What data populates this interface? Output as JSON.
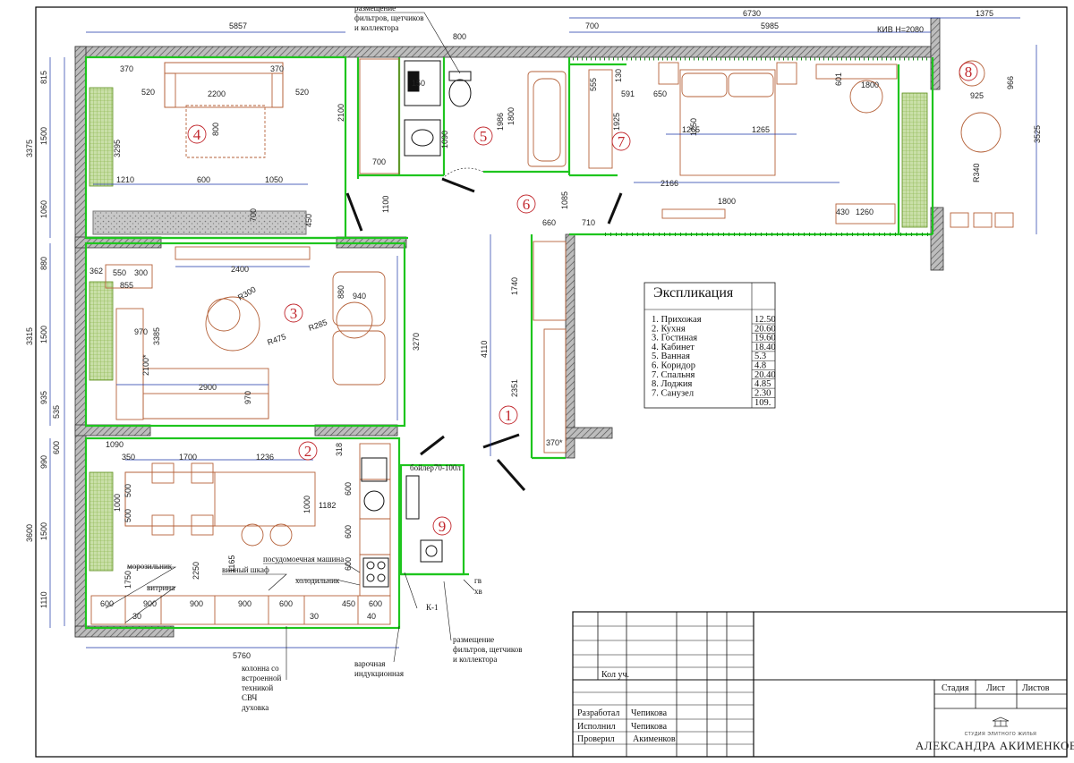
{
  "rooms": {
    "r1": "1",
    "r2": "2",
    "r3": "3",
    "r4": "4",
    "r5": "5",
    "r6": "6",
    "r7": "7",
    "r8": "8",
    "r9": "9"
  },
  "dims": {
    "top_left": "5857",
    "top_right": "6730",
    "top_far": "1375",
    "d800": "800",
    "d700a": "700",
    "d5985": "5985",
    "kiv": "КИВ Н=2080",
    "d520a": "520",
    "d2200": "2200",
    "d520b": "520",
    "d370a": "370",
    "d370b": "370",
    "d800b": "800",
    "d3295": "3295",
    "d1210": "1210",
    "d600a": "600",
    "d1050": "1050",
    "d700b": "700",
    "d450a": "450",
    "d2100a": "2100",
    "d1100": "1100",
    "d700c": "700",
    "d1986": "1986",
    "d1800a": "1800",
    "d1090a": "1090",
    "d150": "150",
    "d555": "555",
    "d130": "130",
    "d591": "591",
    "d650": "650",
    "d1925": "1925",
    "d1250": "1250",
    "d1265a": "1265",
    "d1265b": "1265",
    "d2166": "2166",
    "d1800b": "1800",
    "d601": "601",
    "d1800c": "1800",
    "d925": "925",
    "d966": "966",
    "r340": "R340",
    "d3525": "3525",
    "d430": "430",
    "d1260": "1260",
    "d660": "660",
    "d710": "710",
    "d1085": "1085",
    "d2400": "2400",
    "d362": "362",
    "d550": "550",
    "d300": "300",
    "d855": "855",
    "r300": "R300",
    "r285": "R285",
    "r475": "R475",
    "d880": "880",
    "d940": "940",
    "d970a": "970",
    "d3385": "3385",
    "d2100b": "2100*",
    "d2900": "2900",
    "d970b": "970",
    "d3270": "3270",
    "d1740": "1740",
    "d4110": "4110",
    "d2351": "2351",
    "d370c": "370*",
    "d1090b": "1090",
    "d1700": "1700",
    "d1236": "1236",
    "d318": "318",
    "d350": "350",
    "d1000a": "1000",
    "d500a": "500",
    "d500b": "500",
    "d1000b": "1000",
    "d1182": "1182",
    "d600b": "600",
    "d600c": "600",
    "d600d": "600",
    "d2250": "2250",
    "d1165": "1165",
    "d1750": "1750",
    "d30a": "30",
    "d30b": "30",
    "d5760": "5760",
    "w600a": "600",
    "w900a": "900",
    "w900b": "900",
    "w900c": "900",
    "w600b": "600",
    "w450": "450",
    "w600c": "600",
    "w40": "40",
    "left815": "815",
    "left1500a": "1500",
    "left3375": "3375",
    "left1060": "1060",
    "left880": "880",
    "left1500b": "1500",
    "left3315": "3315",
    "left935": "935",
    "left535": "535",
    "left990": "990",
    "left600": "600",
    "left1500c": "1500",
    "left3600": "3600",
    "left1110": "1110"
  },
  "labels": {
    "filters_top": "размещение фильтров, щетчиков и коллектора",
    "filters_bottom": "размещение фильтров, щетчиков и коллектора",
    "boiler": "бойлер70-100л",
    "dishwasher": "посудомоечная машина",
    "wine": "винный шкаф",
    "fridge": "холодильник",
    "freezer": "морозильник",
    "showcase": "витрина",
    "column": "колонна со встроенной техникой СВЧ духовка",
    "hob": "варочная индукционная",
    "k1": "К-1",
    "gv": "гв",
    "hv": "хв"
  },
  "explication": {
    "title": "Экспликация",
    "rows": [
      {
        "name": "1. Прихожая",
        "area": "12.50"
      },
      {
        "name": "2. Кухня",
        "area": "20.60"
      },
      {
        "name": "3. Гостиная",
        "area": "19.60"
      },
      {
        "name": "4. Кабинет",
        "area": "18.40"
      },
      {
        "name": "5. Ванная",
        "area": "5.3"
      },
      {
        "name": "6. Коридор",
        "area": "4.8"
      },
      {
        "name": "7. Спальня",
        "area": "20.40"
      },
      {
        "name": "8. Лоджия",
        "area": "4.85"
      },
      {
        "name": "7. Санузел",
        "area": "2.30"
      }
    ],
    "total": "109."
  },
  "stamp": {
    "kol": "Кол уч.",
    "dev_role": "Разработал",
    "dev_name": "Чепикова",
    "exec_role": "Исполнил",
    "exec_name": "Чепикова",
    "check_role": "Проверил",
    "check_name": "Акименков",
    "stage": "Стадия",
    "sheet": "Лист",
    "sheets": "Листов",
    "studio_small": "СТУДИЯ ЭЛИТНОГО ЖИЛЬЯ",
    "studio_big": "АЛЕКСАНДРА АКИМЕНКОВА"
  }
}
